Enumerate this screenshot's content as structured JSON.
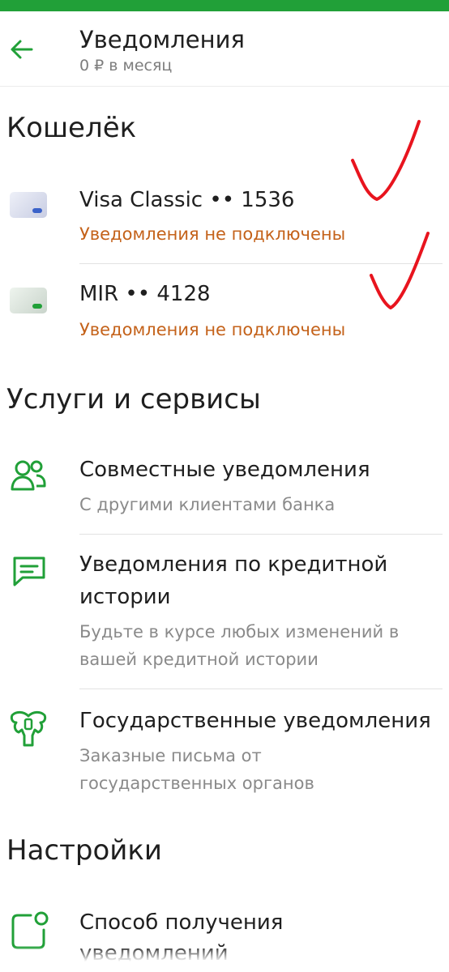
{
  "header": {
    "title": "Уведомления",
    "subtitle": "0 ₽ в месяц"
  },
  "wallet": {
    "section_title": "Кошелёк",
    "cards": [
      {
        "name": "Visa Classic •• 1536",
        "status": "Уведомления не подключены",
        "icon": "card-icon"
      },
      {
        "name": "MIR •• 4128",
        "status": "Уведомления не подключены",
        "icon": "card-icon"
      }
    ]
  },
  "services": {
    "section_title": "Услуги и сервисы",
    "items": [
      {
        "title": "Совместные уведомления",
        "subtitle": "С другими клиентами банка",
        "icon": "people-icon"
      },
      {
        "title_line1": "Уведомления по кредитной",
        "title_line2": "истории",
        "subtitle_line1": "Будьте в курсе любых изменений в",
        "subtitle_line2": "вашей кредитной истории",
        "icon": "message-icon"
      },
      {
        "title": "Государственные уведомления",
        "subtitle_line1": "Заказные письма от",
        "subtitle_line2": "государственных органов",
        "icon": "emblem-icon"
      }
    ]
  },
  "settings": {
    "section_title": "Настройки",
    "items": [
      {
        "title": "Способ получения",
        "title_line2": "уведомлений",
        "icon": "notification-dot-icon"
      }
    ]
  },
  "colors": {
    "accent": "#21a038",
    "warning": "#c4621a",
    "annotation": "#e8141e"
  }
}
